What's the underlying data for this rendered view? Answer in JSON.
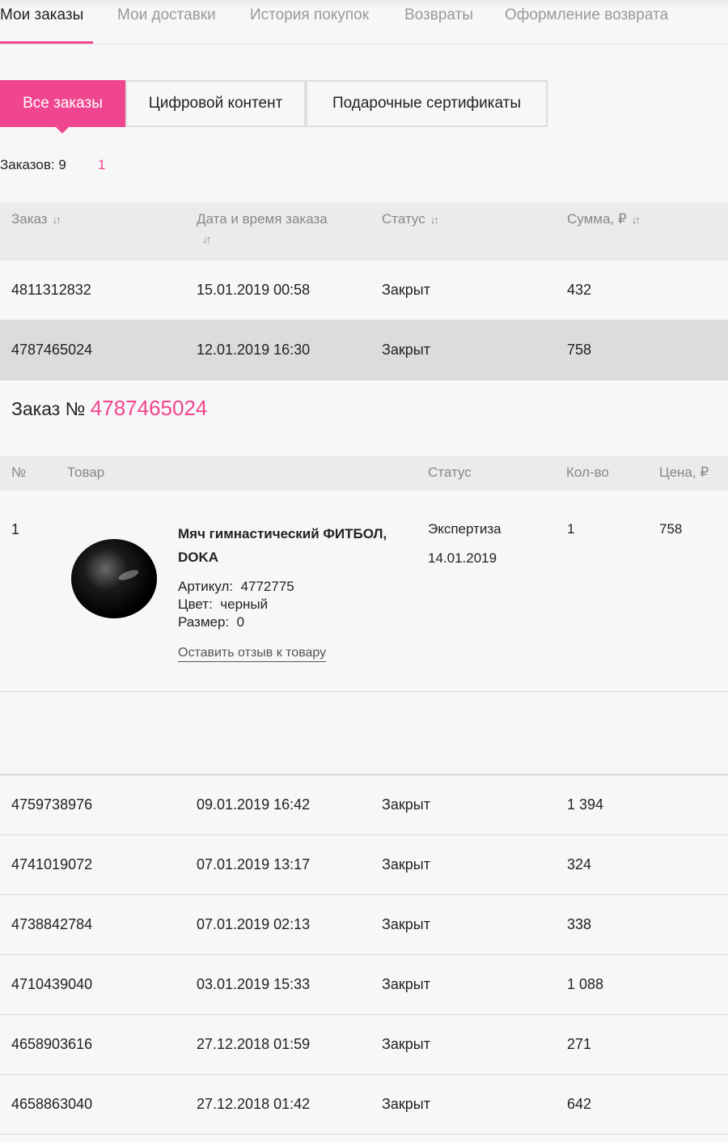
{
  "top_tabs": {
    "my_orders": "Мои заказы",
    "my_deliveries": "Мои доставки",
    "purchase_history": "История покупок",
    "returns": "Возвраты",
    "return_request": "Оформление возврата"
  },
  "segments": {
    "all_orders": "Все заказы",
    "digital": "Цифровой контент",
    "gift_cards": "Подарочные сертификаты"
  },
  "summary": {
    "count_label": "Заказов: 9",
    "page": "1"
  },
  "orders_table": {
    "headers": {
      "order": "Заказ",
      "date": "Дата и время заказа",
      "status": "Статус",
      "sum": "Сумма, ₽",
      "sort_glyph": "↓↑"
    },
    "rows": [
      {
        "id": "4811312832",
        "date": "15.01.2019 00:58",
        "status": "Закрыт",
        "sum": "432"
      },
      {
        "id": "4787465024",
        "date": "12.01.2019 16:30",
        "status": "Закрыт",
        "sum": "758"
      },
      {
        "id": "4759738976",
        "date": "09.01.2019 16:42",
        "status": "Закрыт",
        "sum": "1 394"
      },
      {
        "id": "4741019072",
        "date": "07.01.2019 13:17",
        "status": "Закрыт",
        "sum": "324"
      },
      {
        "id": "4738842784",
        "date": "07.01.2019 02:13",
        "status": "Закрыт",
        "sum": "338"
      },
      {
        "id": "4710439040",
        "date": "03.01.2019 15:33",
        "status": "Закрыт",
        "sum": "1 088"
      },
      {
        "id": "4658903616",
        "date": "27.12.2018 01:59",
        "status": "Закрыт",
        "sum": "271"
      },
      {
        "id": "4658863040",
        "date": "27.12.2018 01:42",
        "status": "Закрыт",
        "sum": "642"
      }
    ]
  },
  "detail": {
    "title_prefix": "Заказ №",
    "order_number": "4787465024",
    "headers": {
      "num": "№",
      "product": "Товар",
      "status": "Статус",
      "qty": "Кол-во",
      "price": "Цена, ₽"
    },
    "item": {
      "index": "1",
      "name": "Мяч гимнастический ФИТБОЛ, DOKA",
      "article_label": "Артикул:",
      "article": "4772775",
      "color_label": "Цвет:",
      "color": "черный",
      "size_label": "Размер:",
      "size": "0",
      "review_link": "Оставить отзыв к товару",
      "status": "Экспертиза",
      "status_date": "14.01.2019",
      "qty": "1",
      "price": "758"
    }
  },
  "colors": {
    "accent": "#f0468f",
    "header_bg": "#ebebeb",
    "selected_row": "#dcdcdc"
  },
  "icons": {
    "sort": "sort-arrows-icon",
    "product": "fitball-image"
  }
}
